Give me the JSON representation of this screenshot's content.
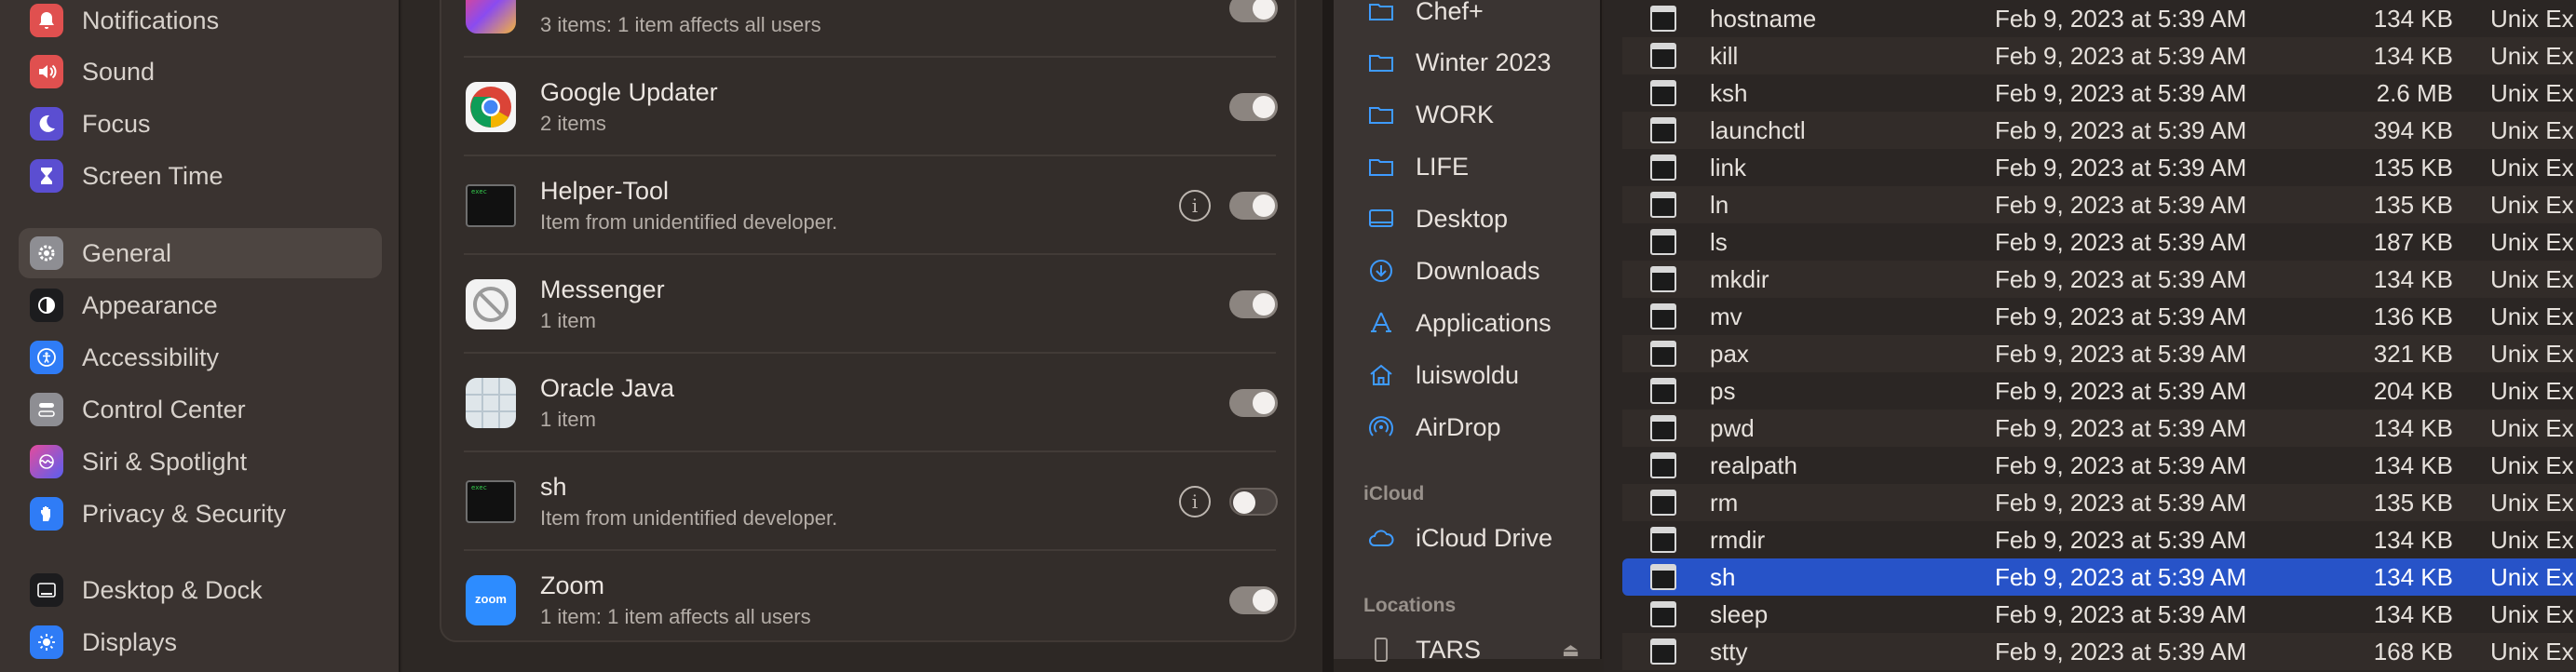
{
  "settings_sidebar": {
    "items": [
      {
        "label": "Notifications",
        "icon": "bell-icon",
        "color": "#e0504f"
      },
      {
        "label": "Sound",
        "icon": "speaker-icon",
        "color": "#e0504f"
      },
      {
        "label": "Focus",
        "icon": "moon-icon",
        "color": "#5b4ed1"
      },
      {
        "label": "Screen Time",
        "icon": "hourglass-icon",
        "color": "#5b4ed1"
      },
      {
        "label": "General",
        "icon": "gear-icon",
        "color": "#8e8e93",
        "selected": true
      },
      {
        "label": "Appearance",
        "icon": "appearance-icon",
        "color": "#1c1c1e"
      },
      {
        "label": "Accessibility",
        "icon": "accessibility-icon",
        "color": "#2f7cf6"
      },
      {
        "label": "Control Center",
        "icon": "control-center-icon",
        "color": "#8e8e93"
      },
      {
        "label": "Siri & Spotlight",
        "icon": "siri-icon",
        "color": "#b44be0"
      },
      {
        "label": "Privacy & Security",
        "icon": "hand-icon",
        "color": "#2f7cf6"
      },
      {
        "label": "Desktop & Dock",
        "icon": "dock-icon",
        "color": "#1c1c1e"
      },
      {
        "label": "Displays",
        "icon": "sun-icon",
        "color": "#2f7cf6"
      }
    ]
  },
  "login_items": [
    {
      "title": "",
      "subtitle": "3 items: 1 item affects all users",
      "icon": "creative-cloud-icon",
      "toggle": "on",
      "info": false
    },
    {
      "title": "Google Updater",
      "subtitle": "2 items",
      "icon": "chrome-icon",
      "toggle": "on",
      "info": false
    },
    {
      "title": "Helper-Tool",
      "subtitle": "Item from unidentified developer.",
      "icon": "exec-icon",
      "toggle": "on",
      "info": true
    },
    {
      "title": "Messenger",
      "subtitle": "1 item",
      "icon": "prohibited-icon",
      "toggle": "on",
      "info": false
    },
    {
      "title": "Oracle Java",
      "subtitle": "1 item",
      "icon": "generic-app-icon",
      "toggle": "on",
      "info": false
    },
    {
      "title": "sh",
      "subtitle": "Item from unidentified developer.",
      "icon": "exec-icon",
      "toggle": "off",
      "info": true
    },
    {
      "title": "Zoom",
      "subtitle": "1 item: 1 item affects all users",
      "icon": "zoom-icon",
      "toggle": "on",
      "info": false
    }
  ],
  "exec_label": "exec",
  "zoom_label": "zoom",
  "finder_sidebar": {
    "favorites": [
      {
        "label": "Chef+",
        "icon": "folder-icon"
      },
      {
        "label": "Winter 2023",
        "icon": "folder-icon"
      },
      {
        "label": "WORK",
        "icon": "folder-icon"
      },
      {
        "label": "LIFE",
        "icon": "folder-icon"
      },
      {
        "label": "Desktop",
        "icon": "desktop-icon"
      },
      {
        "label": "Downloads",
        "icon": "download-icon"
      },
      {
        "label": "Applications",
        "icon": "applications-icon"
      },
      {
        "label": "luiswoldu",
        "icon": "home-icon"
      },
      {
        "label": "AirDrop",
        "icon": "airdrop-icon"
      }
    ],
    "icloud_header": "iCloud",
    "icloud_items": [
      {
        "label": "iCloud Drive",
        "icon": "cloud-icon"
      }
    ],
    "locations_header": "Locations",
    "location_items": [
      {
        "label": "TARS",
        "icon": "drive-icon"
      }
    ],
    "eject_glyph": "⏏"
  },
  "files": [
    {
      "name": "hostname",
      "date": "Feb 9, 2023 at 5:39 AM",
      "size": "134 KB",
      "kind": "Unix Ex"
    },
    {
      "name": "kill",
      "date": "Feb 9, 2023 at 5:39 AM",
      "size": "134 KB",
      "kind": "Unix Ex"
    },
    {
      "name": "ksh",
      "date": "Feb 9, 2023 at 5:39 AM",
      "size": "2.6 MB",
      "kind": "Unix Ex"
    },
    {
      "name": "launchctl",
      "date": "Feb 9, 2023 at 5:39 AM",
      "size": "394 KB",
      "kind": "Unix Ex"
    },
    {
      "name": "link",
      "date": "Feb 9, 2023 at 5:39 AM",
      "size": "135 KB",
      "kind": "Unix Ex"
    },
    {
      "name": "ln",
      "date": "Feb 9, 2023 at 5:39 AM",
      "size": "135 KB",
      "kind": "Unix Ex"
    },
    {
      "name": "ls",
      "date": "Feb 9, 2023 at 5:39 AM",
      "size": "187 KB",
      "kind": "Unix Ex"
    },
    {
      "name": "mkdir",
      "date": "Feb 9, 2023 at 5:39 AM",
      "size": "134 KB",
      "kind": "Unix Ex"
    },
    {
      "name": "mv",
      "date": "Feb 9, 2023 at 5:39 AM",
      "size": "136 KB",
      "kind": "Unix Ex"
    },
    {
      "name": "pax",
      "date": "Feb 9, 2023 at 5:39 AM",
      "size": "321 KB",
      "kind": "Unix Ex"
    },
    {
      "name": "ps",
      "date": "Feb 9, 2023 at 5:39 AM",
      "size": "204 KB",
      "kind": "Unix Ex"
    },
    {
      "name": "pwd",
      "date": "Feb 9, 2023 at 5:39 AM",
      "size": "134 KB",
      "kind": "Unix Ex"
    },
    {
      "name": "realpath",
      "date": "Feb 9, 2023 at 5:39 AM",
      "size": "134 KB",
      "kind": "Unix Ex"
    },
    {
      "name": "rm",
      "date": "Feb 9, 2023 at 5:39 AM",
      "size": "135 KB",
      "kind": "Unix Ex"
    },
    {
      "name": "rmdir",
      "date": "Feb 9, 2023 at 5:39 AM",
      "size": "134 KB",
      "kind": "Unix Ex"
    },
    {
      "name": "sh",
      "date": "Feb 9, 2023 at 5:39 AM",
      "size": "134 KB",
      "kind": "Unix Ex",
      "selected": true
    },
    {
      "name": "sleep",
      "date": "Feb 9, 2023 at 5:39 AM",
      "size": "134 KB",
      "kind": "Unix Ex"
    },
    {
      "name": "stty",
      "date": "Feb 9, 2023 at 5:39 AM",
      "size": "168 KB",
      "kind": "Unix Ex"
    }
  ]
}
